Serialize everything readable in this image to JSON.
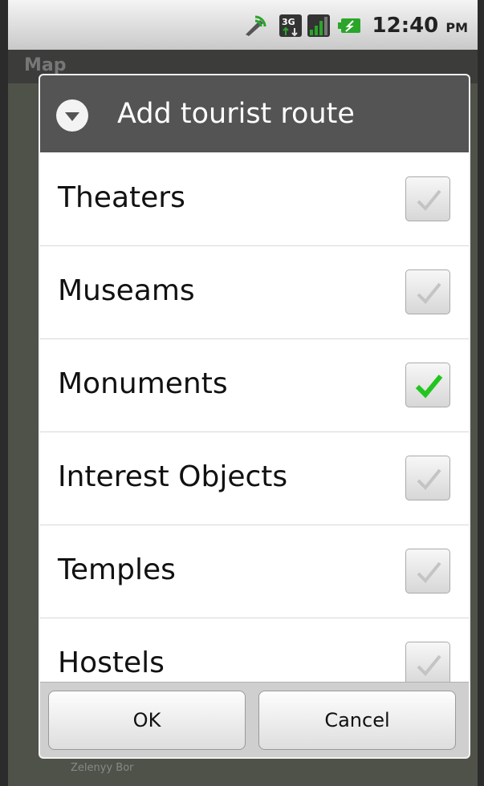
{
  "status_bar": {
    "time": "12:40",
    "ampm": "PM",
    "icons": [
      "signal-waves-icon",
      "3g-network-icon",
      "cell-signal-icon",
      "battery-charging-icon"
    ]
  },
  "app": {
    "title": "Map"
  },
  "map": {
    "labels": [
      "Zelenyy Bor"
    ]
  },
  "dialog": {
    "title": "Add tourist route",
    "icon": "chevron-down-circle-icon",
    "items": [
      {
        "label": "Theaters",
        "checked": false
      },
      {
        "label": "Museams",
        "checked": false
      },
      {
        "label": "Monuments",
        "checked": true
      },
      {
        "label": "Interest Objects",
        "checked": false
      },
      {
        "label": "Temples",
        "checked": false
      },
      {
        "label": "Hostels",
        "checked": false
      }
    ],
    "ok_label": "OK",
    "cancel_label": "Cancel"
  },
  "colors": {
    "checked": "#22c51f",
    "unchecked": "#c4c4c4",
    "header": "#545454"
  }
}
